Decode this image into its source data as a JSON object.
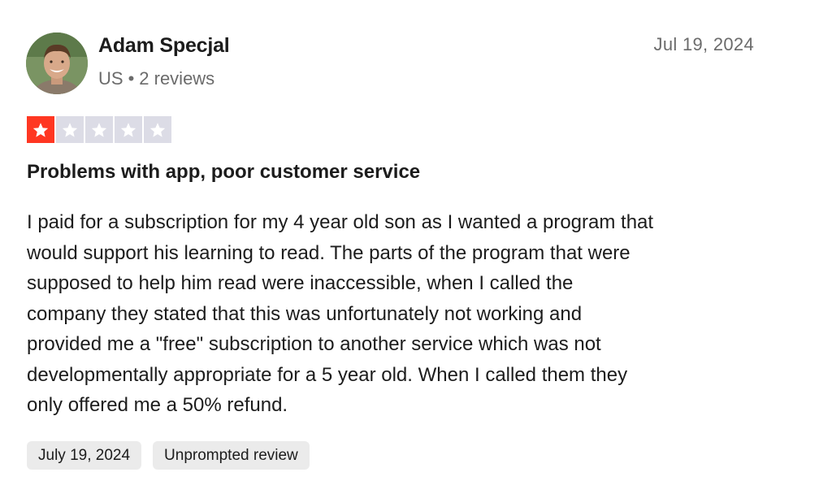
{
  "author": {
    "name": "Adam Specjal",
    "country": "US",
    "separator": "•",
    "reviews_count": "2 reviews"
  },
  "review": {
    "date": "Jul 19, 2024",
    "rating": 1,
    "rating_max": 5,
    "title": "Problems with app, poor customer service",
    "body_lines": [
      "I paid for a subscription for my 4 year old son as I wanted a program that",
      "would support his learning to read. The parts of the program that were",
      "supposed to help him read were inaccessible, when I called the",
      "company they stated that this was unfortunately not working and",
      "provided me a \"free\" subscription to another service which was not",
      "developmentally appropriate for a 5 year old. When I called them they",
      "only offered me a 50% refund."
    ],
    "tags": [
      "July 19, 2024",
      "Unprompted review"
    ]
  },
  "colors": {
    "star_filled": "#ff3722",
    "star_empty": "#dcdce6",
    "tag_bg": "#ebebeb",
    "muted_text": "#6b6b6b"
  },
  "icons": {
    "star": "star-icon",
    "avatar": "user-avatar"
  }
}
